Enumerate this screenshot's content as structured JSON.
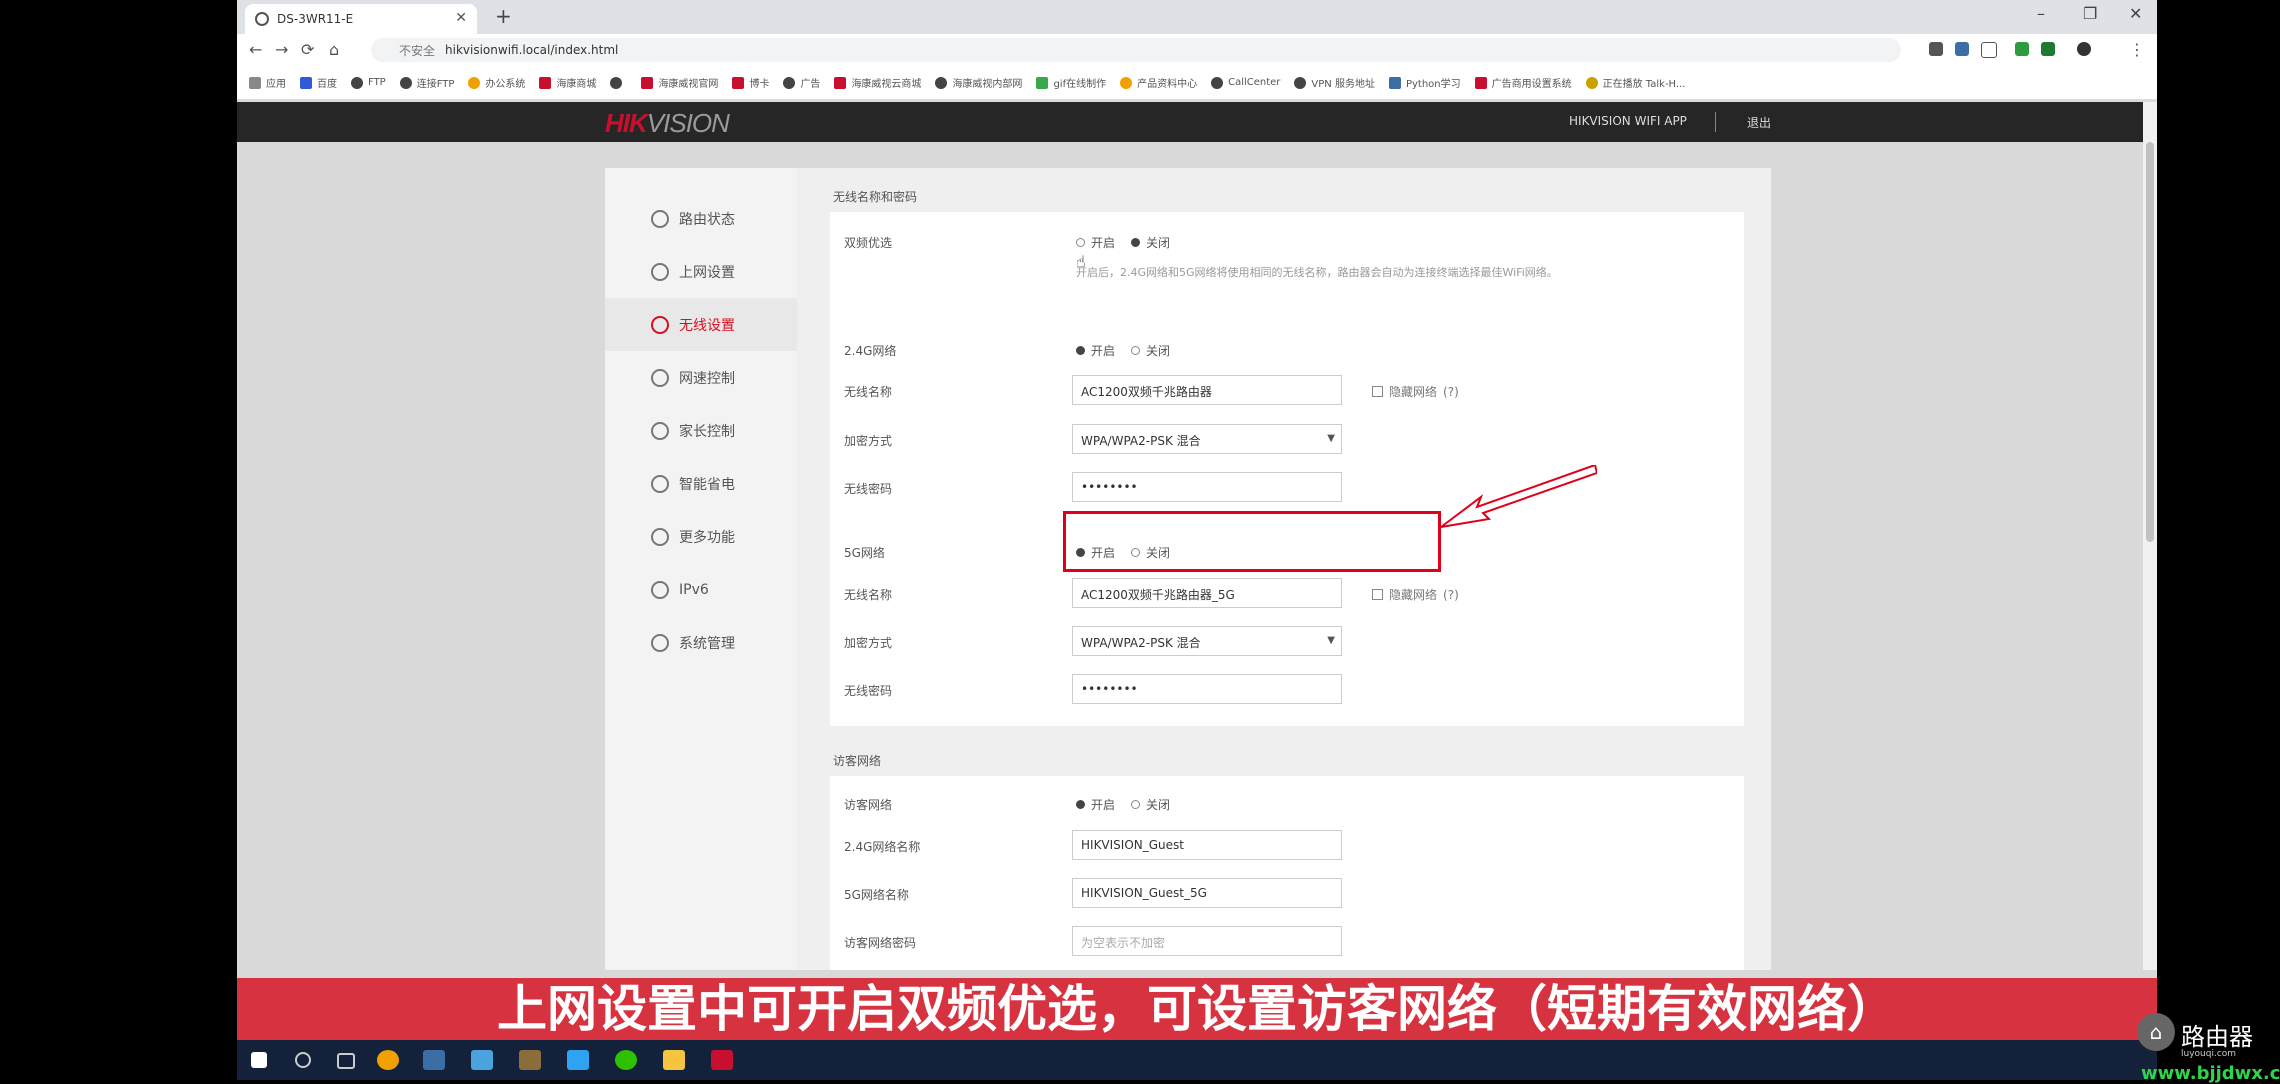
{
  "browser": {
    "tab_title": "DS-3WR11-E",
    "new_tab": "+",
    "window_controls": [
      "–",
      "❐",
      "✕"
    ],
    "nav": [
      "←",
      "→",
      "⟳",
      "⌂"
    ],
    "security_label": "不安全",
    "url": "hikvisionwifi.local/index.html",
    "bookmarks": [
      "应用",
      "百度",
      "FTP",
      "连接FTP",
      "办公系统",
      "海康商城",
      "",
      "海康威视官网",
      "博卡",
      "广告",
      "海康威视云商城",
      "海康威视内部网",
      "gif在线制作",
      "产品资料中心",
      "CallCenter",
      "VPN 服务地址",
      "Python学习",
      "广告商用设置系统",
      "正在播放 Talk-H..."
    ]
  },
  "header": {
    "logo_red": "HIK",
    "logo_grey": "VISION",
    "app_link": "HIKVISION WIFI APP",
    "logout": "退出"
  },
  "sidebar": {
    "items": [
      {
        "label": "路由状态",
        "icon": "status-icon",
        "active": false
      },
      {
        "label": "上网设置",
        "icon": "globe-icon",
        "active": false
      },
      {
        "label": "无线设置",
        "icon": "wifi-icon",
        "active": true
      },
      {
        "label": "网速控制",
        "icon": "speed-icon",
        "active": false
      },
      {
        "label": "家长控制",
        "icon": "home-icon",
        "active": false
      },
      {
        "label": "智能省电",
        "icon": "power-icon",
        "active": false
      },
      {
        "label": "更多功能",
        "icon": "grid-icon",
        "active": false
      },
      {
        "label": "IPv6",
        "icon": "ipv6-icon",
        "active": false
      },
      {
        "label": "系统管理",
        "icon": "gear-icon",
        "active": false
      }
    ]
  },
  "wireless": {
    "section_title": "无线名称和密码",
    "dual_band": {
      "label": "双频优选",
      "on": "开启",
      "off": "关闭",
      "selected": "off",
      "hint": "开启后，2.4G网络和5G网络将使用相同的无线名称，路由器会自动为连接终端选择最佳WiFi网络。"
    },
    "band24": {
      "label": "2.4G网络",
      "on": "开启",
      "off": "关闭",
      "selected": "on",
      "ssid_label": "无线名称",
      "ssid": "AC1200双频千兆路由器",
      "hide_label": "隐藏网络",
      "hide_help": "(?)",
      "enc_label": "加密方式",
      "enc": "WPA/WPA2-PSK 混合",
      "pwd_label": "无线密码",
      "pwd": "••••••••"
    },
    "band5": {
      "label": "5G网络",
      "on": "开启",
      "off": "关闭",
      "selected": "on",
      "ssid_label": "无线名称",
      "ssid": "AC1200双频千兆路由器_5G",
      "hide_label": "隐藏网络",
      "hide_help": "(?)",
      "enc_label": "加密方式",
      "enc": "WPA/WPA2-PSK 混合",
      "pwd_label": "无线密码",
      "pwd": "••••••••"
    }
  },
  "guest": {
    "section_title": "访客网络",
    "label": "访客网络",
    "on": "开启",
    "off": "关闭",
    "selected": "on",
    "ssid24_label": "2.4G网络名称",
    "ssid24": "HIKVISION_Guest",
    "ssid5_label": "5G网络名称",
    "ssid5": "HIKVISION_Guest_5G",
    "pwd_label": "访客网络密码",
    "pwd_placeholder": "为空表示不加密"
  },
  "caption": "上网设置中可开启双频优选，可设置访客网络（短期有效网络）",
  "watermark": {
    "name": "路由器",
    "domain": "luyouqi.com",
    "site": "www.bjjdwx.com"
  },
  "colors": {
    "brand_red": "#c8102e",
    "active_red": "#d7101f",
    "caption_bg": "#d6323f",
    "annotation_red": "#e0001a"
  }
}
